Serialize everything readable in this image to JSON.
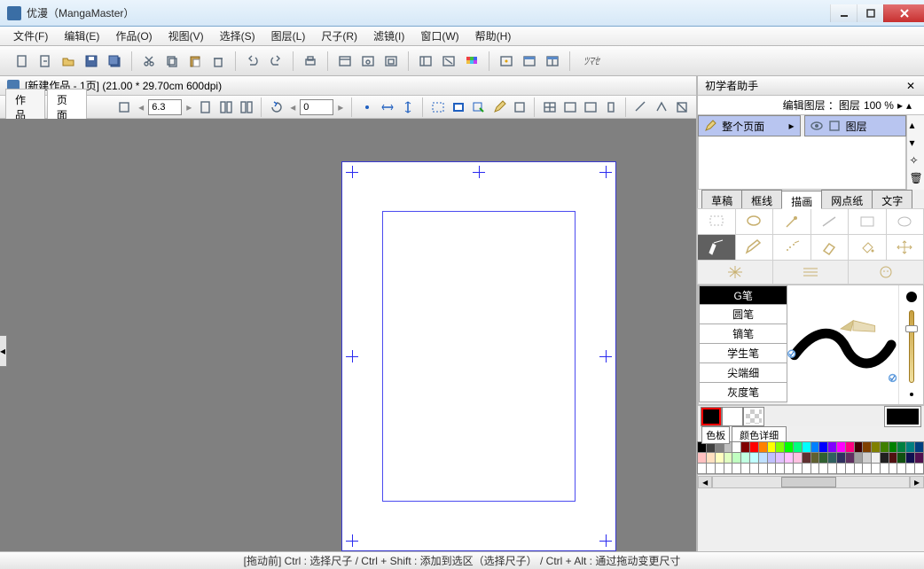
{
  "window": {
    "title": "优漫（MangaMaster）"
  },
  "menus": [
    "文件(F)",
    "编辑(E)",
    "作品(O)",
    "视图(V)",
    "选择(S)",
    "图层(L)",
    "尺子(R)",
    "滤镜(I)",
    "窗口(W)",
    "帮助(H)"
  ],
  "document": {
    "title": "[新建作品 - 1页] (21.00 * 29.70cm 600dpi)",
    "tabs": {
      "works": "作品",
      "page": "页面"
    },
    "zoom": "6.3",
    "rotate": "0"
  },
  "right": {
    "title": "初学者助手",
    "layer_label": "编辑图层 ：图层",
    "layer_pct": "100 %",
    "page_cell": "整个页面",
    "layer_cell": "图层"
  },
  "tool_tabs": [
    "草稿",
    "框线",
    "描画",
    "网点纸",
    "文字"
  ],
  "active_tool_tab": 2,
  "brushes": [
    "G笔",
    "圆笔",
    "镝笔",
    "学生笔",
    "尖端细",
    "灰度笔"
  ],
  "active_brush": 0,
  "color_tabs": {
    "label": "色板",
    "detail": "颜色详细"
  },
  "palette": [
    [
      "#000000",
      "#404040",
      "#808080",
      "#c0c0c0",
      "#ffffff",
      "#800000",
      "#ff0000",
      "#ff8000",
      "#ffff00",
      "#80ff00",
      "#00ff00",
      "#00ff80",
      "#00ffff",
      "#0080ff",
      "#0000ff",
      "#8000ff",
      "#ff00ff",
      "#ff0080",
      "#400000",
      "#804000",
      "#808000",
      "#408000",
      "#008000",
      "#008040",
      "#008080",
      "#004080"
    ],
    [
      "#ffc0c0",
      "#ffe0c0",
      "#ffffc0",
      "#e0ffc0",
      "#c0ffc0",
      "#c0ffe0",
      "#c0ffff",
      "#c0e0ff",
      "#c0c0ff",
      "#e0c0ff",
      "#ffc0ff",
      "#ffc0e0",
      "#603030",
      "#606030",
      "#306030",
      "#306060",
      "#303060",
      "#603060",
      "#a0a0a0",
      "#d0d0d0",
      "#f0f0f0",
      "#202020",
      "#501010",
      "#105010",
      "#101050",
      "#501050"
    ],
    [
      "#ffffff",
      "#ffffff",
      "#ffffff",
      "#ffffff",
      "#ffffff",
      "#ffffff",
      "#ffffff",
      "#ffffff",
      "#ffffff",
      "#ffffff",
      "#ffffff",
      "#ffffff",
      "#ffffff",
      "#ffffff",
      "#ffffff",
      "#ffffff",
      "#ffffff",
      "#ffffff",
      "#ffffff",
      "#ffffff",
      "#ffffff",
      "#ffffff",
      "#ffffff",
      "#ffffff",
      "#ffffff",
      "#ffffff"
    ]
  ],
  "status": "[拖动前] Ctrl : 选择尺子 / Ctrl + Shift : 添加到选区（选择尺子） / Ctrl + Alt : 通过拖动变更尺寸"
}
